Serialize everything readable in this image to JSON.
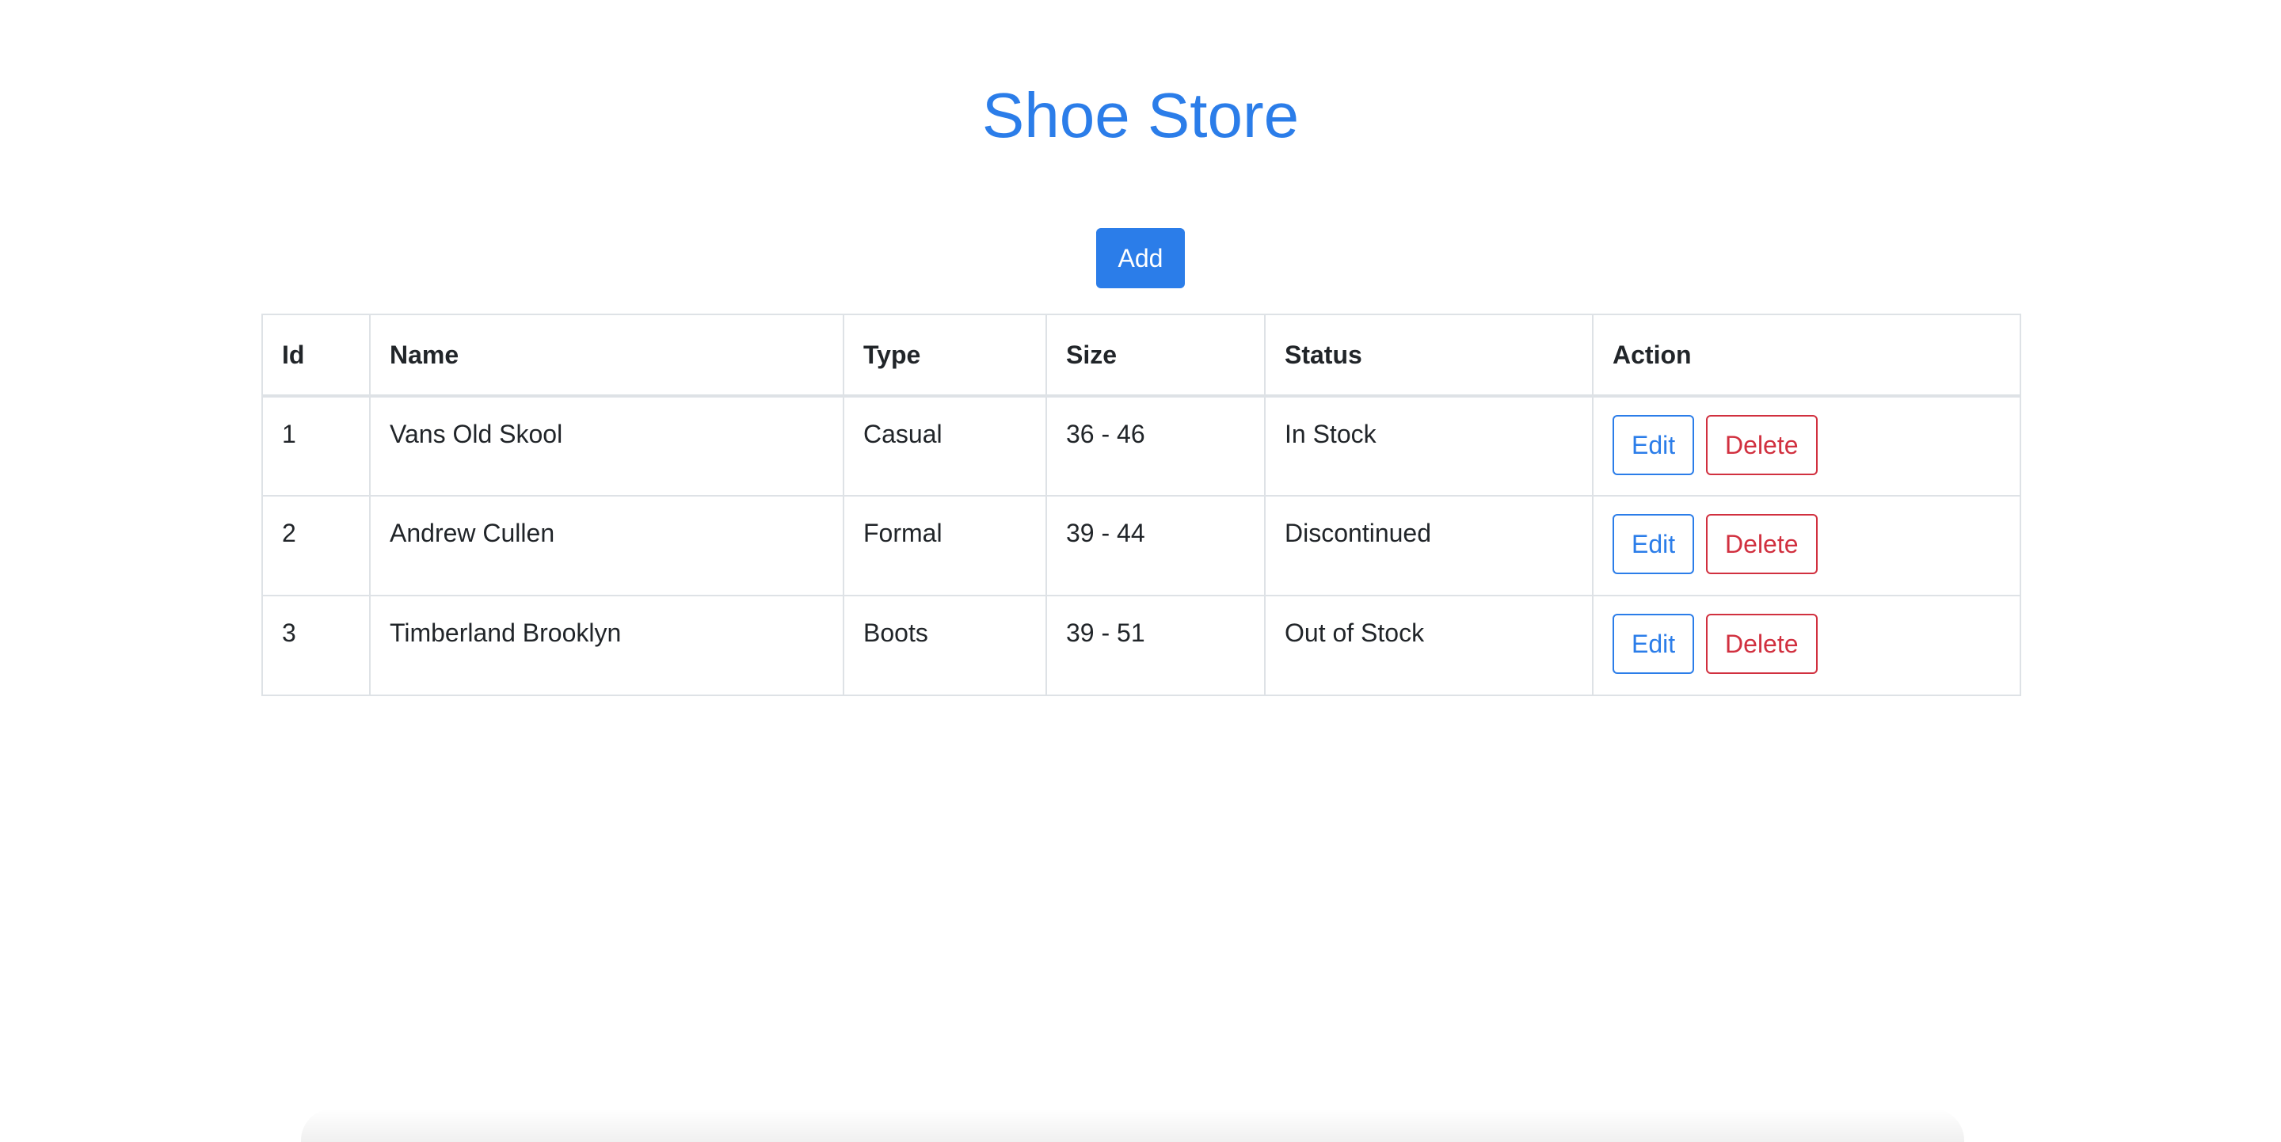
{
  "page": {
    "title": "Shoe Store",
    "add_label": "Add"
  },
  "table": {
    "headers": [
      "Id",
      "Name",
      "Type",
      "Size",
      "Status",
      "Action"
    ],
    "rows": [
      {
        "id": "1",
        "name": "Vans Old Skool",
        "type": "Casual",
        "size": "36 - 46",
        "status": "In Stock"
      },
      {
        "id": "2",
        "name": "Andrew Cullen",
        "type": "Formal",
        "size": "39 - 44",
        "status": "Discontinued"
      },
      {
        "id": "3",
        "name": "Timberland Brooklyn",
        "type": "Boots",
        "size": "39 - 51",
        "status": "Out of Stock"
      }
    ],
    "edit_label": "Edit",
    "delete_label": "Delete"
  },
  "colors": {
    "primary": "#2b7de9",
    "danger": "#d1303f",
    "text": "#212529",
    "border": "#dee2e6"
  }
}
